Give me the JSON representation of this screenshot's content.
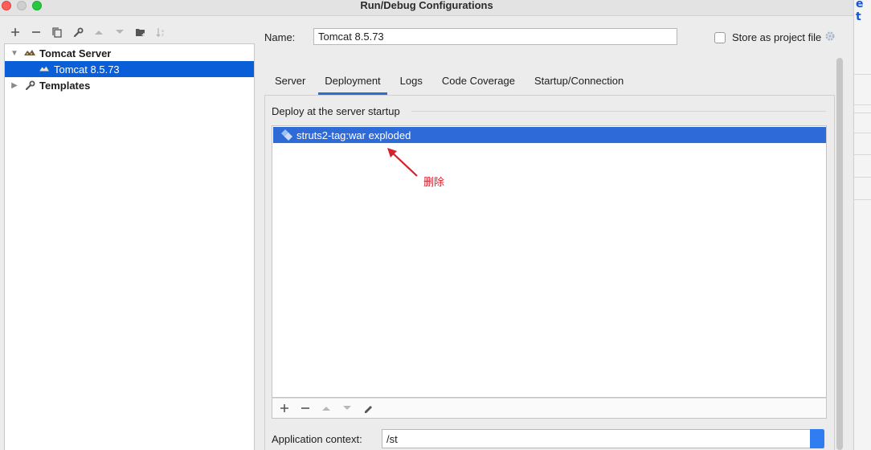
{
  "window": {
    "title": "Run/Debug Configurations"
  },
  "background_window": {
    "visible_glyph": "e t"
  },
  "toolbar": {
    "buttons": [
      "add-icon",
      "remove-icon",
      "copy-icon",
      "wrench-icon",
      "move-up-icon",
      "move-down-icon",
      "folder-add-icon",
      "sort-icon"
    ]
  },
  "tree": {
    "items": [
      {
        "label": "Tomcat Server",
        "expanded": true,
        "bold": true,
        "icon": "tomcat-icon"
      },
      {
        "label": "Tomcat 8.5.73",
        "selected": true,
        "icon": "tomcat-icon"
      },
      {
        "label": "Templates",
        "expanded": false,
        "bold": true,
        "icon": "wrench-icon"
      }
    ]
  },
  "form": {
    "name_label": "Name:",
    "name_value": "Tomcat 8.5.73",
    "store_label": "Store as project file",
    "store_checked": false
  },
  "tabs": [
    {
      "label": "Server",
      "active": false
    },
    {
      "label": "Deployment",
      "active": true
    },
    {
      "label": "Logs",
      "active": false
    },
    {
      "label": "Code Coverage",
      "active": false
    },
    {
      "label": "Startup/Connection",
      "active": false
    }
  ],
  "deployment": {
    "group_title": "Deploy at the server startup",
    "items": [
      {
        "label": "struts2-tag:war exploded",
        "selected": true,
        "icon": "artifact-icon"
      }
    ],
    "list_toolbar": [
      "add-icon",
      "remove-icon",
      "move-up-icon",
      "move-down-icon",
      "edit-icon"
    ],
    "context_label": "Application context:",
    "context_value": "/st"
  },
  "annotation": {
    "text": "删除",
    "color": "#d2222d"
  },
  "colors": {
    "selection": "#0a5fd8",
    "list_selection": "#2f6bd8",
    "tab_underline": "#2f6bd4"
  }
}
